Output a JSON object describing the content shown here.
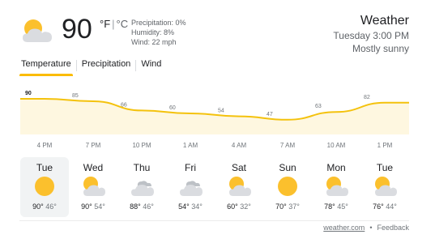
{
  "current": {
    "icon": "partly-sunny-icon",
    "temperature": "90",
    "unit_f": "°F",
    "unit_sep": "|",
    "unit_c": "°C",
    "precipitation": "Precipitation: 0%",
    "humidity": "Humidity: 8%",
    "wind": "Wind: 22 mph"
  },
  "header": {
    "title": "Weather",
    "datetime": "Tuesday 3:00 PM",
    "condition": "Mostly sunny"
  },
  "tabs": [
    {
      "label": "Temperature",
      "active": true
    },
    {
      "label": "Precipitation",
      "active": false
    },
    {
      "label": "Wind",
      "active": false
    }
  ],
  "colors": {
    "accent": "#fbbc04",
    "area_fill": "#fef7e0",
    "line": "#f4c20d"
  },
  "chart_data": {
    "type": "area",
    "x": [
      "4 PM",
      "7 PM",
      "10 PM",
      "1 AM",
      "4 AM",
      "7 AM",
      "10 AM",
      "1 PM"
    ],
    "values": [
      90,
      85,
      66,
      60,
      54,
      47,
      63,
      82
    ],
    "series": [
      {
        "values": [
          90,
          85,
          66,
          60,
          54,
          47,
          63,
          82
        ]
      }
    ]
  },
  "forecast": [
    {
      "day": "Tue",
      "icon": "sunny-icon",
      "high": "90°",
      "low": "46°",
      "selected": true
    },
    {
      "day": "Wed",
      "icon": "partly-sunny-icon",
      "high": "90°",
      "low": "54°"
    },
    {
      "day": "Thu",
      "icon": "cloudy-icon",
      "high": "88°",
      "low": "46°"
    },
    {
      "day": "Fri",
      "icon": "cloudy-icon",
      "high": "54°",
      "low": "34°"
    },
    {
      "day": "Sat",
      "icon": "partly-sunny-icon",
      "high": "60°",
      "low": "32°"
    },
    {
      "day": "Sun",
      "icon": "sunny-icon",
      "high": "70°",
      "low": "37°"
    },
    {
      "day": "Mon",
      "icon": "partly-sunny-icon",
      "high": "78°",
      "low": "45°"
    },
    {
      "day": "Tue",
      "icon": "partly-sunny-icon",
      "high": "76°",
      "low": "44°"
    }
  ],
  "footer": {
    "source": "weather.com",
    "separator": "•",
    "feedback": "Feedback"
  }
}
